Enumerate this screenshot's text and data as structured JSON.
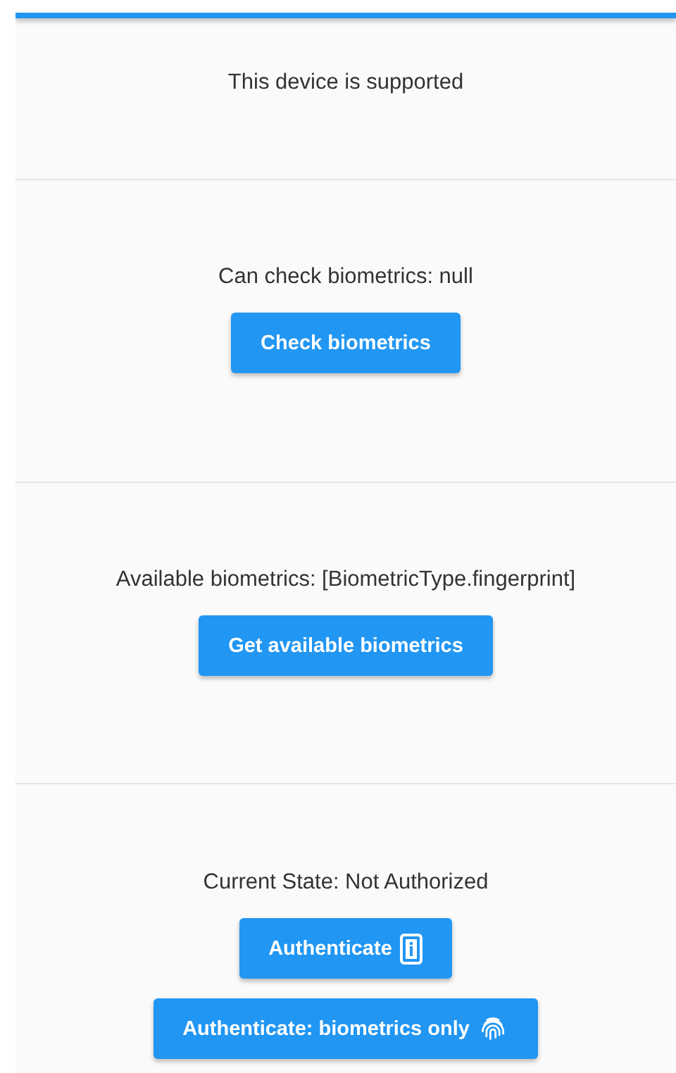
{
  "sections": [
    {
      "status": "This device is supported"
    },
    {
      "status": "Can check biometrics: null",
      "buttons": [
        {
          "label": "Check biometrics"
        }
      ]
    },
    {
      "status": "Available biometrics: [BiometricType.fingerprint]",
      "buttons": [
        {
          "label": "Get available biometrics"
        }
      ]
    },
    {
      "status": "Current State: Not Authorized",
      "buttons": [
        {
          "label": "Authenticate",
          "kind": "device"
        },
        {
          "label": "Authenticate: biometrics only",
          "kind": "biometric"
        }
      ]
    }
  ]
}
